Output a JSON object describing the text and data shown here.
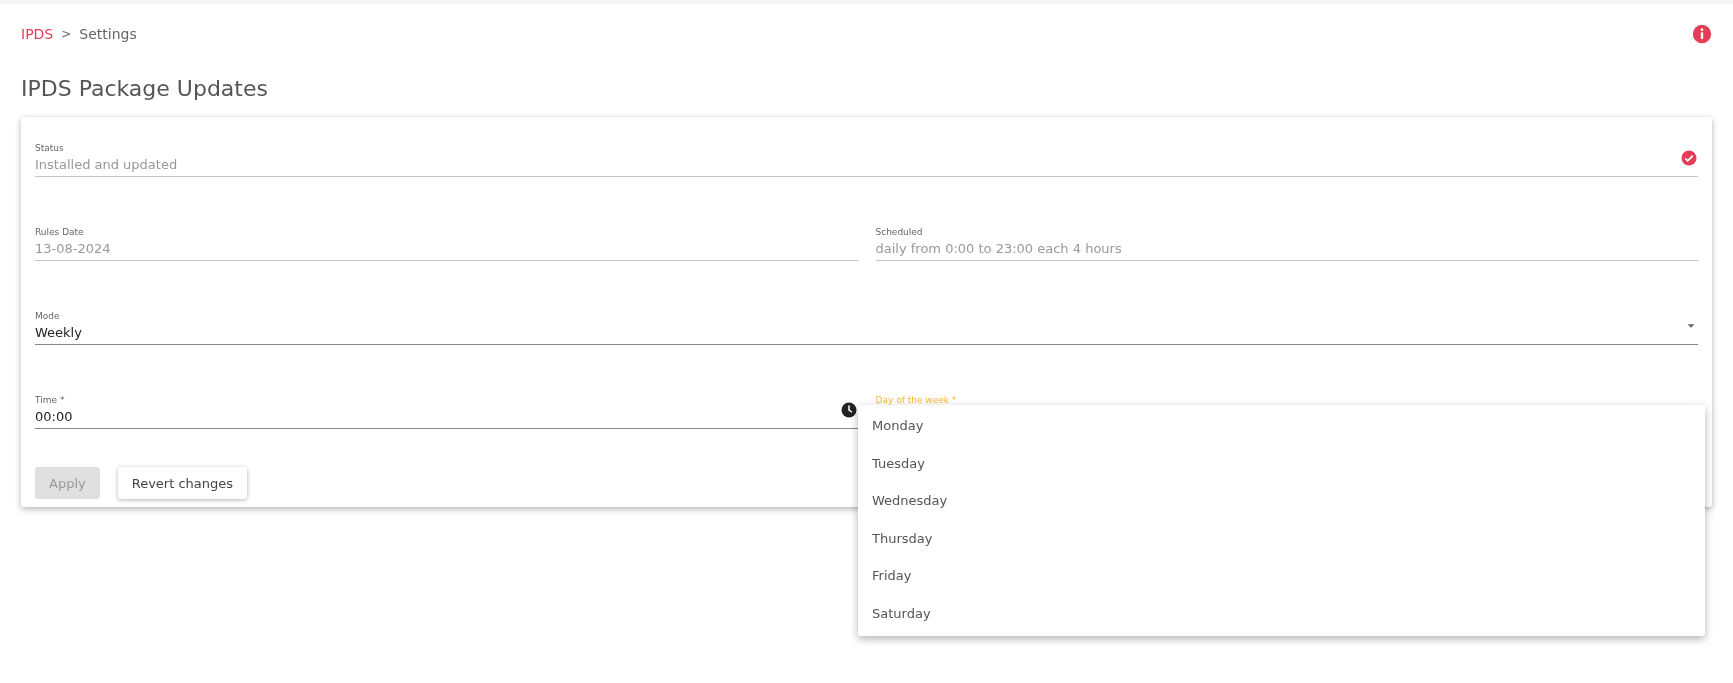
{
  "breadcrumb": {
    "items": [
      {
        "label": "IPDS",
        "kind": "link"
      },
      {
        "label": "Settings",
        "kind": "current"
      }
    ],
    "separator": ">"
  },
  "page_title": "IPDS Package Updates",
  "form": {
    "status": {
      "label": "Status",
      "value": "Installed and updated"
    },
    "rules_date": {
      "label": "Rules Date",
      "value": "13-08-2024"
    },
    "scheduled": {
      "label": "Scheduled",
      "value": "daily from 0:00 to 23:00 each 4 hours"
    },
    "mode": {
      "label": "Mode",
      "value": "Weekly"
    },
    "time": {
      "label": "Time *",
      "value": "00:00"
    },
    "day_of_week": {
      "label": "Day of the week *",
      "focused": true
    },
    "buttons": [
      {
        "label": "Apply",
        "disabled": true
      },
      {
        "label": "Revert changes",
        "disabled": false
      }
    ]
  },
  "dropdown": {
    "options": [
      "Monday",
      "Tuesday",
      "Wednesday",
      "Thursday",
      "Friday",
      "Saturday"
    ]
  }
}
